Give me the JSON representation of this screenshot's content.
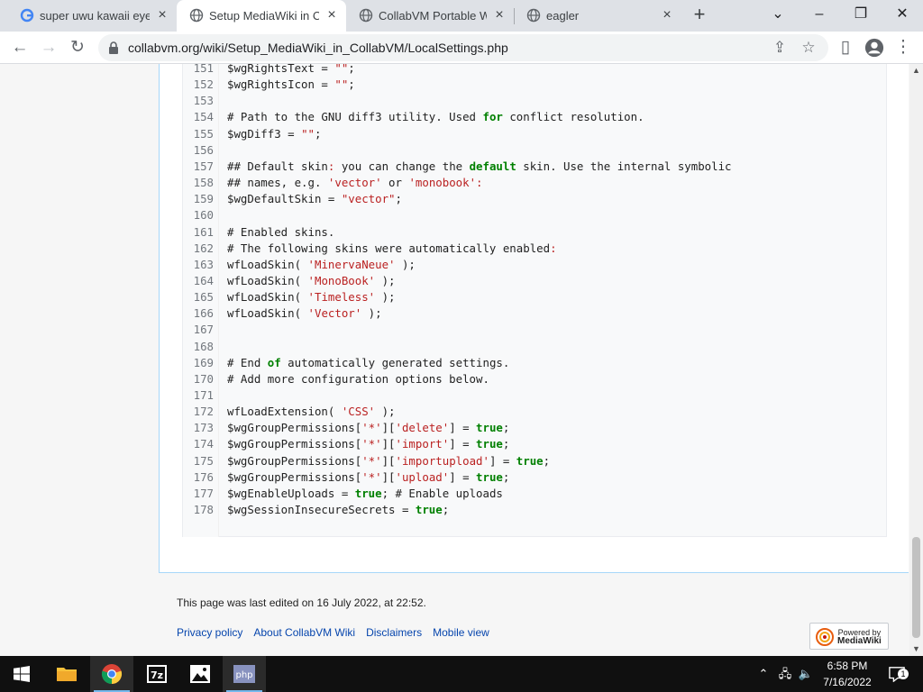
{
  "browser": {
    "tabs": [
      {
        "title": "super uwu kawaii eyes",
        "active": false
      },
      {
        "title": "Setup MediaWiki in Co",
        "active": true
      },
      {
        "title": "CollabVM Portable Wik",
        "active": false
      },
      {
        "title": "eagler",
        "active": false
      }
    ],
    "url": "collabvm.org/wiki/Setup_MediaWiki_in_CollabVM/LocalSettings.php"
  },
  "code": [
    {
      "n": "151",
      "t": [
        [
          "c",
          "$wgRightsText = "
        ],
        [
          "s",
          "\"\""
        ],
        [
          "c",
          ";"
        ]
      ]
    },
    {
      "n": "152",
      "t": [
        [
          "c",
          "$wgRightsIcon = "
        ],
        [
          "s",
          "\"\""
        ],
        [
          "c",
          ";"
        ]
      ]
    },
    {
      "n": "153",
      "t": []
    },
    {
      "n": "154",
      "t": [
        [
          "c",
          "# Path to the GNU diff3 utility. Used "
        ],
        [
          "k",
          "for"
        ],
        [
          "c",
          " conflict resolution."
        ]
      ]
    },
    {
      "n": "155",
      "t": [
        [
          "c",
          "$wgDiff3 = "
        ],
        [
          "s",
          "\"\""
        ],
        [
          "c",
          ";"
        ]
      ]
    },
    {
      "n": "156",
      "t": []
    },
    {
      "n": "157",
      "t": [
        [
          "c",
          "## Default skin"
        ],
        [
          "s",
          ":"
        ],
        [
          "c",
          " you can change the "
        ],
        [
          "k",
          "default"
        ],
        [
          "c",
          " skin. Use the internal symbolic"
        ]
      ]
    },
    {
      "n": "158",
      "t": [
        [
          "c",
          "## names, e.g. "
        ],
        [
          "s",
          "'vector'"
        ],
        [
          "c",
          " or "
        ],
        [
          "s",
          "'monobook'"
        ],
        [
          "s",
          ":"
        ]
      ]
    },
    {
      "n": "159",
      "t": [
        [
          "c",
          "$wgDefaultSkin = "
        ],
        [
          "s",
          "\"vector\""
        ],
        [
          "c",
          ";"
        ]
      ]
    },
    {
      "n": "160",
      "t": []
    },
    {
      "n": "161",
      "t": [
        [
          "c",
          "# Enabled skins."
        ]
      ]
    },
    {
      "n": "162",
      "t": [
        [
          "c",
          "# The following skins were automatically enabled"
        ],
        [
          "s",
          ":"
        ]
      ]
    },
    {
      "n": "163",
      "t": [
        [
          "c",
          "wfLoadSkin( "
        ],
        [
          "s",
          "'MinervaNeue'"
        ],
        [
          "c",
          " );"
        ]
      ]
    },
    {
      "n": "164",
      "t": [
        [
          "c",
          "wfLoadSkin( "
        ],
        [
          "s",
          "'MonoBook'"
        ],
        [
          "c",
          " );"
        ]
      ]
    },
    {
      "n": "165",
      "t": [
        [
          "c",
          "wfLoadSkin( "
        ],
        [
          "s",
          "'Timeless'"
        ],
        [
          "c",
          " );"
        ]
      ]
    },
    {
      "n": "166",
      "t": [
        [
          "c",
          "wfLoadSkin( "
        ],
        [
          "s",
          "'Vector'"
        ],
        [
          "c",
          " );"
        ]
      ]
    },
    {
      "n": "167",
      "t": []
    },
    {
      "n": "168",
      "t": []
    },
    {
      "n": "169",
      "t": [
        [
          "c",
          "# End "
        ],
        [
          "k",
          "of"
        ],
        [
          "c",
          " automatically generated settings."
        ]
      ]
    },
    {
      "n": "170",
      "t": [
        [
          "c",
          "# Add more configuration options below."
        ]
      ]
    },
    {
      "n": "171",
      "t": []
    },
    {
      "n": "172",
      "t": [
        [
          "c",
          "wfLoadExtension( "
        ],
        [
          "s",
          "'CSS'"
        ],
        [
          "c",
          " );"
        ]
      ]
    },
    {
      "n": "173",
      "t": [
        [
          "c",
          "$wgGroupPermissions["
        ],
        [
          "s",
          "'*'"
        ],
        [
          "c",
          "]["
        ],
        [
          "s",
          "'delete'"
        ],
        [
          "c",
          "] = "
        ],
        [
          "k",
          "true"
        ],
        [
          "c",
          ";"
        ]
      ]
    },
    {
      "n": "174",
      "t": [
        [
          "c",
          "$wgGroupPermissions["
        ],
        [
          "s",
          "'*'"
        ],
        [
          "c",
          "]["
        ],
        [
          "s",
          "'import'"
        ],
        [
          "c",
          "] = "
        ],
        [
          "k",
          "true"
        ],
        [
          "c",
          ";"
        ]
      ]
    },
    {
      "n": "175",
      "t": [
        [
          "c",
          "$wgGroupPermissions["
        ],
        [
          "s",
          "'*'"
        ],
        [
          "c",
          "]["
        ],
        [
          "s",
          "'importupload'"
        ],
        [
          "c",
          "] = "
        ],
        [
          "k",
          "true"
        ],
        [
          "c",
          ";"
        ]
      ]
    },
    {
      "n": "176",
      "t": [
        [
          "c",
          "$wgGroupPermissions["
        ],
        [
          "s",
          "'*'"
        ],
        [
          "c",
          "]["
        ],
        [
          "s",
          "'upload'"
        ],
        [
          "c",
          "] = "
        ],
        [
          "k",
          "true"
        ],
        [
          "c",
          ";"
        ]
      ]
    },
    {
      "n": "177",
      "t": [
        [
          "c",
          "$wgEnableUploads = "
        ],
        [
          "k",
          "true"
        ],
        [
          "c",
          "; # Enable uploads"
        ]
      ]
    },
    {
      "n": "178",
      "t": [
        [
          "c",
          "$wgSessionInsecureSecrets = "
        ],
        [
          "k",
          "true"
        ],
        [
          "c",
          ";"
        ]
      ]
    }
  ],
  "footer": {
    "last_edited": "This page was last edited on 16 July 2022, at 22:52.",
    "links": [
      "Privacy policy",
      "About CollabVM Wiki",
      "Disclaimers",
      "Mobile view"
    ],
    "powered_line1": "Powered by",
    "powered_line2": "MediaWiki"
  },
  "taskbar": {
    "time": "6:58 PM",
    "date": "7/16/2022",
    "notification_count": "1",
    "apps": [
      "file-explorer",
      "chrome",
      "7-zip",
      "photos",
      "php"
    ]
  },
  "colors": {
    "string": "#ba2121",
    "keyword": "#008000",
    "link": "#0645ad"
  }
}
